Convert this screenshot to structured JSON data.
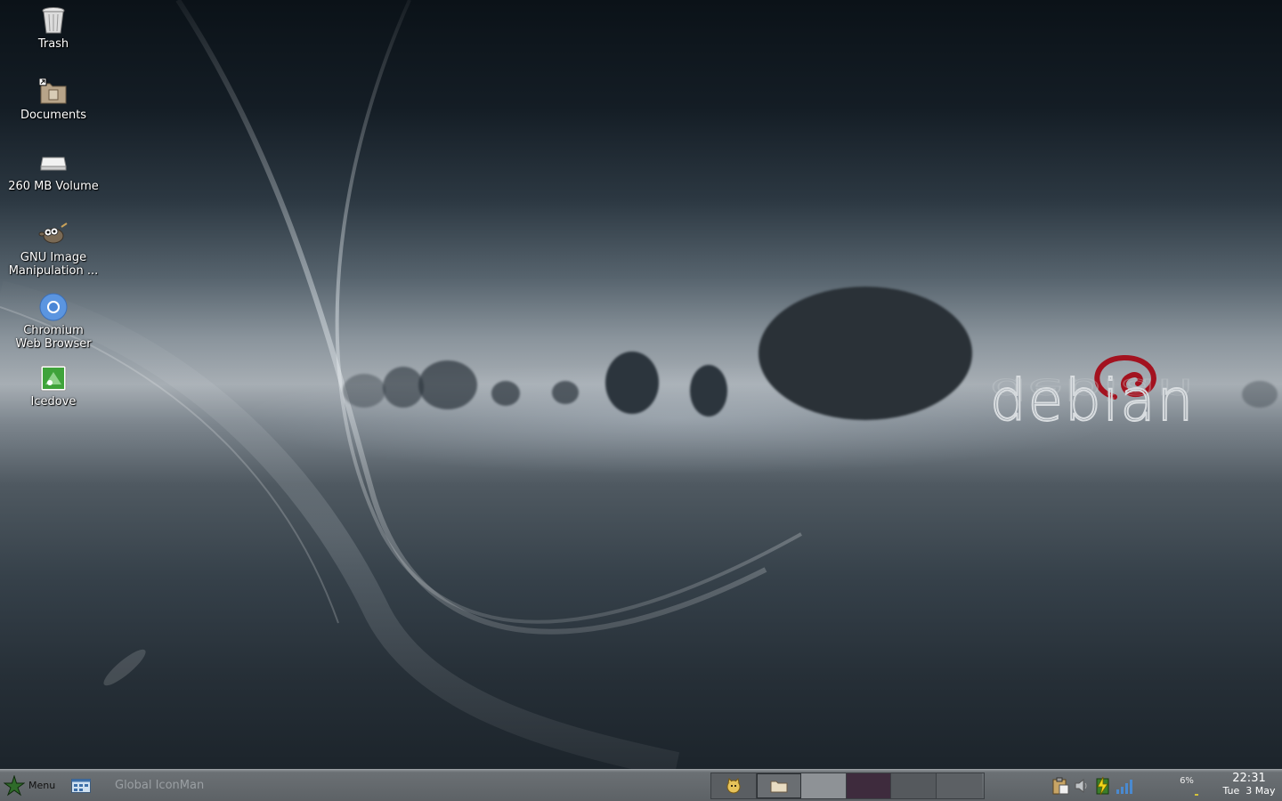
{
  "desktop": {
    "icons": [
      {
        "label": "Trash",
        "icon": "trash-icon"
      },
      {
        "label": "Documents",
        "icon": "folder-link-icon"
      },
      {
        "label": "260 MB Volume",
        "icon": "drive-icon"
      },
      {
        "label": "GNU Image Manipulation ...",
        "icon": "gimp-icon"
      },
      {
        "label": "Chromium Web Browser",
        "icon": "chromium-icon"
      },
      {
        "label": "Icedove",
        "icon": "icedove-icon"
      }
    ],
    "logo_text": "debian"
  },
  "taskbar": {
    "menu_label": "Menu",
    "iconman_label": "Global IconMan",
    "workspaces_count": 6,
    "battery_percent": "6%",
    "clock": {
      "time": "22:31",
      "day": "Tue",
      "date": "3 May"
    }
  },
  "colors": {
    "taskbar_bg": "#5d6266",
    "workspace_active": "#3e2b3d",
    "debian_red": "#a3121f"
  }
}
